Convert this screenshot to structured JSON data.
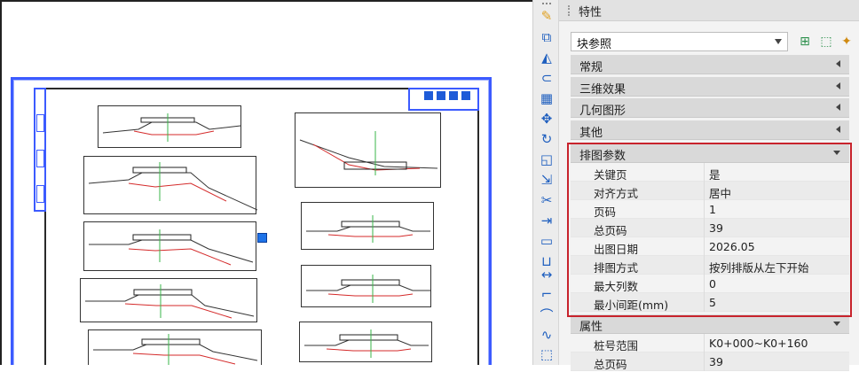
{
  "panel": {
    "title": "特性",
    "type_selector": "块参照",
    "categories": {
      "general": "常规",
      "three_d": "三维效果",
      "geometry": "几何图形",
      "misc": "其他",
      "layout_params": "排图参数",
      "attributes": "属性"
    },
    "layout_rows": [
      {
        "key": "关键页",
        "value": "是"
      },
      {
        "key": "对齐方式",
        "value": "居中"
      },
      {
        "key": "页码",
        "value": "1"
      },
      {
        "key": "总页码",
        "value": "39"
      },
      {
        "key": "出图日期",
        "value": "2026.05"
      },
      {
        "key": "排图方式",
        "value": "按列排版从左下开始"
      },
      {
        "key": "最大列数",
        "value": "0"
      },
      {
        "key": "最小间距(mm)",
        "value": "5"
      }
    ],
    "attribute_rows": [
      {
        "key": "桩号范围",
        "value": "K0+000~K0+160"
      },
      {
        "key": "总页码",
        "value": "39"
      }
    ]
  },
  "colors": {
    "selection_blue": "#3c5bff",
    "highlight_red": "#c8232c",
    "accent_blue": "#1f5fbf"
  },
  "icons": {
    "toolbar": [
      "eraser-icon",
      "copy-icon",
      "mirror-icon",
      "offset-icon",
      "array-icon",
      "move-icon",
      "rotate-icon",
      "scale-icon",
      "stretch-icon",
      "trim-icon",
      "extend-icon",
      "break-icon",
      "join-icon",
      "chamfer-icon",
      "fillet-icon",
      "spline-icon",
      "explode-icon"
    ]
  }
}
